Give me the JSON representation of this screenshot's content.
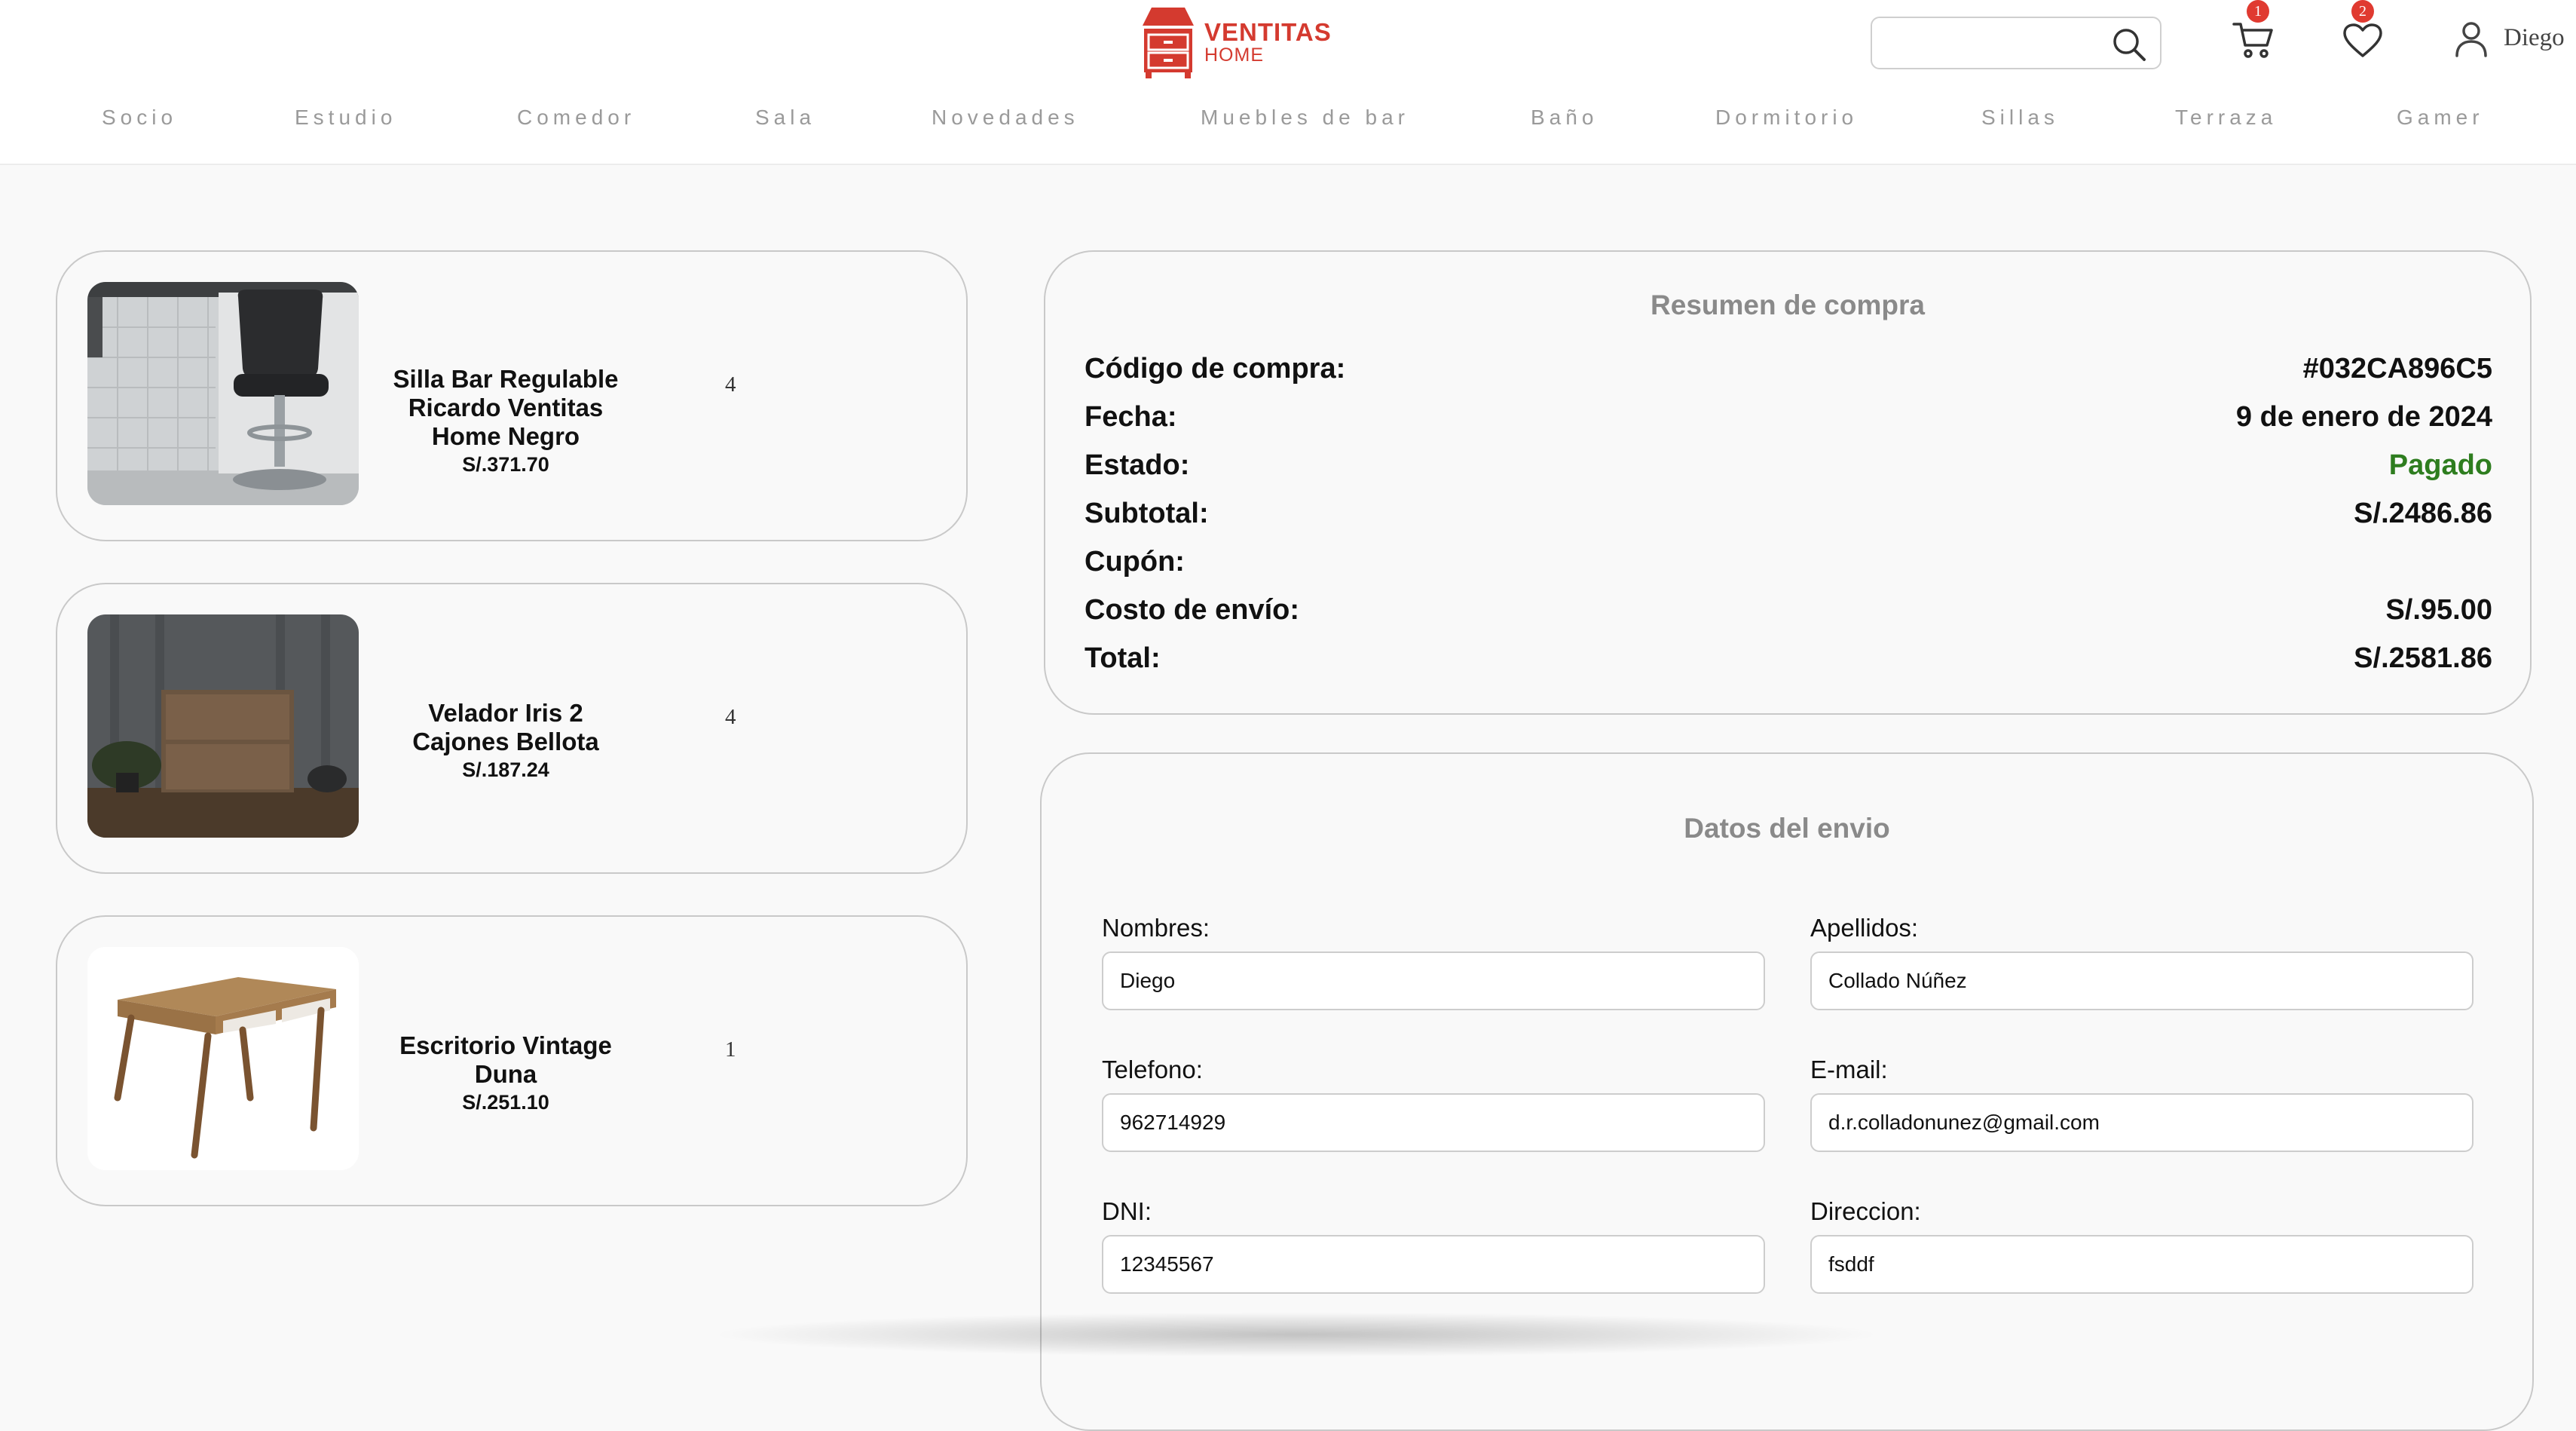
{
  "brand": {
    "line1": "VENTITAS",
    "line2": "HOME",
    "color": "#d43a2f"
  },
  "search": {
    "placeholder": "",
    "value": ""
  },
  "header_icons": {
    "cart_count": "1",
    "wishlist_count": "2",
    "user_name": "Diego"
  },
  "nav": [
    "Socio",
    "Estudio",
    "Comedor",
    "Sala",
    "Novedades",
    "Muebles de bar",
    "Baño",
    "Dormitorio",
    "Sillas",
    "Terraza",
    "Gamer"
  ],
  "cart_items": [
    {
      "name": "Silla Bar Regulable Ricardo Ventitas Home Negro",
      "price": "S/.371.70",
      "quantity": "4",
      "image": "bar-stool-image"
    },
    {
      "name": "Velador Iris 2 Cajones Bellota",
      "price": "S/.187.24",
      "quantity": "4",
      "image": "nightstand-image"
    },
    {
      "name": "Escritorio Vintage Duna",
      "price": "S/.251.10",
      "quantity": "1",
      "image": "desk-image"
    }
  ],
  "summary": {
    "title": "Resumen de compra",
    "rows": [
      {
        "label": "Código de compra:",
        "value": "#032CA896C5"
      },
      {
        "label": "Fecha:",
        "value": "9 de enero de 2024"
      },
      {
        "label": "Estado:",
        "value": "Pagado",
        "color": "#2e7d1f"
      },
      {
        "label": "Subtotal:",
        "value": "S/.2486.86"
      },
      {
        "label": "Cupón:",
        "value": ""
      },
      {
        "label": "Costo de envío:",
        "value": "S/.95.00"
      },
      {
        "label": "Total:",
        "value": "S/.2581.86"
      }
    ]
  },
  "shipping": {
    "title": "Datos del envio",
    "fields": [
      {
        "label": "Nombres:",
        "value": "Diego"
      },
      {
        "label": "Apellidos:",
        "value": "Collado Núñez"
      },
      {
        "label": "Telefono:",
        "value": "962714929"
      },
      {
        "label": "E-mail:",
        "value": "d.r.colladonunez@gmail.com"
      },
      {
        "label": "DNI:",
        "value": "12345567"
      },
      {
        "label": "Direccion:",
        "value": "fsddf"
      }
    ]
  }
}
